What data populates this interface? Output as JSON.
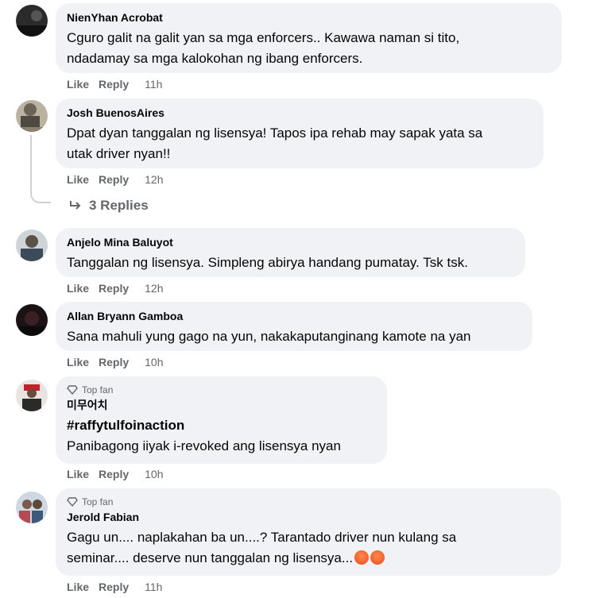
{
  "comments": [
    {
      "author": "NienYhan Acrobat",
      "badge": "",
      "lines": [
        "Cguro galit na galit yan sa mga enforcers.. Kawawa naman si tito,",
        "ndadamay sa mga kalokohan ng ibang enforcers."
      ],
      "like": "Like",
      "reply": "Reply",
      "time": "11h"
    },
    {
      "author": "Josh BuenosAires",
      "badge": "",
      "lines": [
        "Dpat dyan tanggalan ng lisensya! Tapos ipa rehab may sapak yata sa",
        "utak driver nyan!!"
      ],
      "like": "Like",
      "reply": "Reply",
      "time": "12h",
      "replies_label": "3 Replies"
    },
    {
      "author": "Anjelo Mina Baluyot",
      "badge": "",
      "lines": [
        "Tanggalan ng lisensya. Simpleng abirya handang pumatay. Tsk tsk."
      ],
      "like": "Like",
      "reply": "Reply",
      "time": "12h"
    },
    {
      "author": "Allan Bryann Gamboa",
      "badge": "",
      "lines": [
        "Sana mahuli yung gago na yun, nakakaputanginang kamote na yan"
      ],
      "like": "Like",
      "reply": "Reply",
      "time": "10h"
    },
    {
      "author": "미무어치",
      "badge": "Top fan",
      "hashtag": "#raffytulfoinaction",
      "lines": [
        "Panibagong iiyak i-revoked ang lisensya nyan"
      ],
      "like": "Like",
      "reply": "Reply",
      "time": "10h"
    },
    {
      "author": "Jerold Fabian",
      "badge": "Top fan",
      "lines": [
        "Gagu un.... naplakahan ba un....? Tarantado driver nun kulang sa",
        "seminar.... deserve nun tanggalan ng lisensya..."
      ],
      "like": "Like",
      "reply": "Reply",
      "time": "11h"
    }
  ],
  "colors": {
    "bubble": "#f0f2f5",
    "meta": "#65676b",
    "text": "#050505"
  }
}
